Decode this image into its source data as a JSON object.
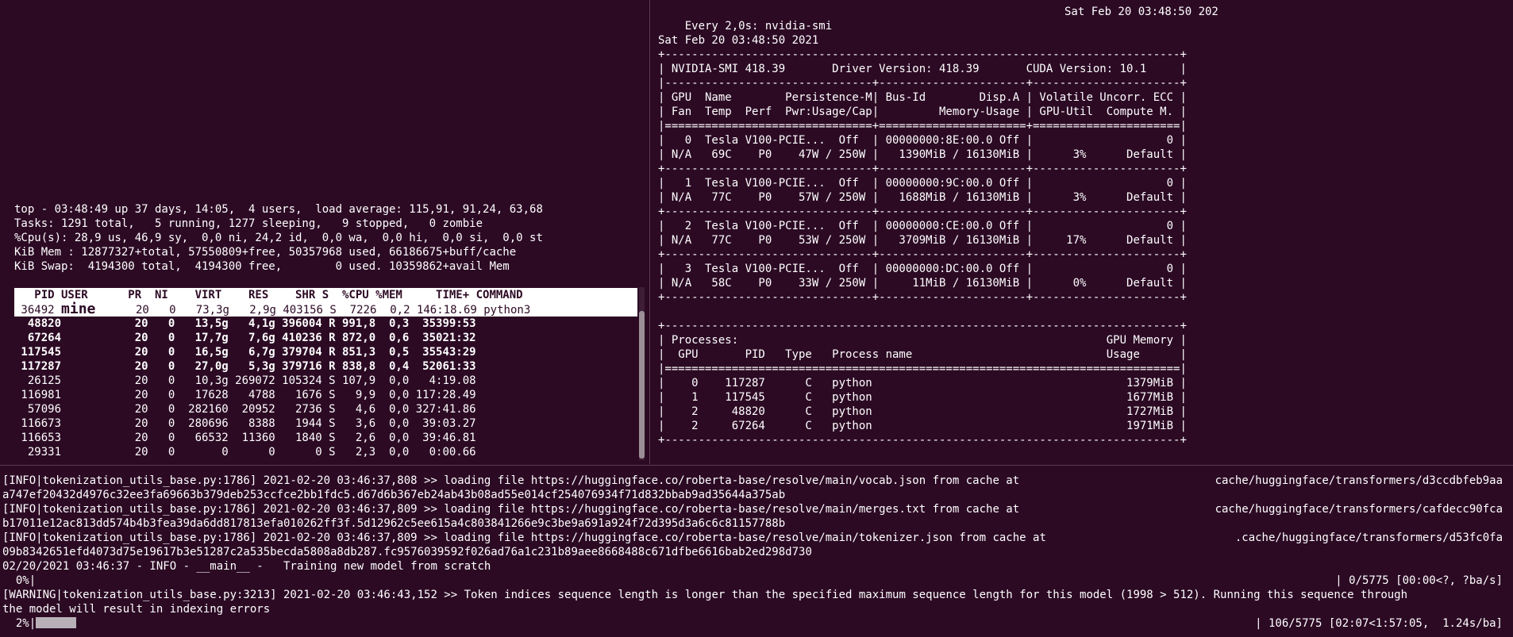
{
  "colors": {
    "background": "#2c0a24",
    "text": "#ffffff",
    "highlight_bg": "#ffffff",
    "highlight_text": "#2c0a24"
  },
  "watch_header": {
    "left": "Every 2,0s: nvidia-smi",
    "right": "Sat Feb 20 03:48:50 202"
  },
  "smi": [
    "Sat Feb 20 03:48:50 2021",
    "+-----------------------------------------------------------------------------+",
    "| NVIDIA-SMI 418.39       Driver Version: 418.39       CUDA Version: 10.1     |",
    "|-------------------------------+----------------------+----------------------+",
    "| GPU  Name        Persistence-M| Bus-Id        Disp.A | Volatile Uncorr. ECC |",
    "| Fan  Temp  Perf  Pwr:Usage/Cap|         Memory-Usage | GPU-Util  Compute M. |",
    "|===============================+======================+======================|",
    "|   0  Tesla V100-PCIE...  Off  | 00000000:8E:00.0 Off |                    0 |",
    "| N/A   69C    P0    47W / 250W |   1390MiB / 16130MiB |      3%      Default |",
    "+-------------------------------+----------------------+----------------------+",
    "|   1  Tesla V100-PCIE...  Off  | 00000000:9C:00.0 Off |                    0 |",
    "| N/A   77C    P0    57W / 250W |   1688MiB / 16130MiB |      3%      Default |",
    "+-------------------------------+----------------------+----------------------+",
    "|   2  Tesla V100-PCIE...  Off  | 00000000:CE:00.0 Off |                    0 |",
    "| N/A   77C    P0    53W / 250W |   3709MiB / 16130MiB |     17%      Default |",
    "+-------------------------------+----------------------+----------------------+",
    "|   3  Tesla V100-PCIE...  Off  | 00000000:DC:00.0 Off |                    0 |",
    "| N/A   58C    P0    33W / 250W |     11MiB / 16130MiB |      0%      Default |",
    "+-------------------------------+----------------------+----------------------+",
    "",
    "+-----------------------------------------------------------------------------+",
    "| Processes:                                                       GPU Memory |",
    "|  GPU       PID   Type   Process name                             Usage      |",
    "|=============================================================================|",
    "|    0    117287      C   python                                      1379MiB |",
    "|    1    117545      C   python                                      1677MiB |",
    "|    2     48820      C   python                                      1727MiB |",
    "|    2     67264      C   python                                      1971MiB |",
    "+-----------------------------------------------------------------------------+"
  ],
  "top": {
    "summary": [
      "top - 03:48:49 up 37 days, 14:05,  4 users,  load average: 115,91, 91,24, 63,68",
      "Tasks: 1291 total,   5 running, 1277 sleeping,   9 stopped,   0 zombie",
      "%Cpu(s): 28,9 us, 46,9 sy,  0,0 ni, 24,2 id,  0,0 wa,  0,0 hi,  0,0 si,  0,0 st",
      "KiB Mem : 12877327+total, 57550809+free, 50357968 used, 66186675+buff/cache",
      "KiB Swap:  4194300 total,  4194300 free,        0 used. 10359862+avail Mem"
    ],
    "header": "   PID USER      PR  NI    VIRT    RES    SHR S  %CPU %MEM     TIME+ COMMAND",
    "selected": {
      "pre": " 36492 ",
      "user": "mine",
      "post": "      20   0   73,3g   2,9g 403156 S  7226  0,2 146:18.69 python3"
    },
    "rows": [
      "  48820           20   0   13,5g   4,1g 396004 R 991,8  0,3  35399:53",
      "  67264           20   0   17,7g   7,6g 410236 R 872,0  0,6  35021:32",
      " 117545           20   0   16,5g   6,7g 379704 R 851,3  0,5  35543:29",
      " 117287           20   0   27,0g   5,3g 379716 R 838,8  0,4  52061:33",
      "  26125           20   0   10,3g 269072 105324 S 107,9  0,0   4:19.08",
      " 116981           20   0   17628   4788   1676 S   9,9  0,0 117:28.49",
      "  57096           20   0  282160  20952   2736 S   4,6  0,0 327:41.86",
      " 116673           20   0  280696   8388   1944 S   3,6  0,0  39:03.27",
      " 116653           20   0   66532  11360   1840 S   2,6  0,0  39:46.81",
      "  29331           20   0       0      0      0 S   2,3  0,0   0:00.66"
    ]
  },
  "log": {
    "l1": {
      "left": "[INFO|tokenization_utils_base.py:1786] 2021-02-20 03:46:37,808 >> loading file https://huggingface.co/roberta-base/resolve/main/vocab.json from cache at",
      "right": "cache/huggingface/transformers/d3ccdbfeb9aa"
    },
    "l2": "a747ef20432d4976c32ee3fa69663b379deb253ccfce2bb1fdc5.d67d6b367eb24ab43b08ad55e014cf254076934f71d832bbab9ad35644a375ab",
    "l3": {
      "left": "[INFO|tokenization_utils_base.py:1786] 2021-02-20 03:46:37,809 >> loading file https://huggingface.co/roberta-base/resolve/main/merges.txt from cache at",
      "right": "cache/huggingface/transformers/cafdecc90fca"
    },
    "l4": "b17011e12ac813dd574b4b3fea39da6dd817813efa010262ff3f.5d12962c5ee615a4c803841266e9c3be9a691a924f72d395d3a6c6c81157788b",
    "l5": {
      "left": "[INFO|tokenization_utils_base.py:1786] 2021-02-20 03:46:37,809 >> loading file https://huggingface.co/roberta-base/resolve/main/tokenizer.json from cache at",
      "right": ".cache/huggingface/transformers/d53fc0fa"
    },
    "l6": "09b8342651efd4073d75e19617b3e51287c2a535becda5808a8db287.fc9576039592f026ad76a1c231b89aee8668488c671dfbe6616bab2ed298d730",
    "l7": "02/20/2021 03:46:37 - INFO - __main__ -   Training new model from scratch",
    "l8": {
      "left": "  0%|",
      "right": "| 0/5775 [00:00<?, ?ba/s]",
      "progress": 0.0
    },
    "l9": "[WARNING|tokenization_utils_base.py:3213] 2021-02-20 03:46:43,152 >> Token indices sequence length is longer than the specified maximum sequence length for this model (1998 > 512). Running this sequence through",
    "l10": "the model will result in indexing errors",
    "l11": {
      "left": "  2%|",
      "right": "| 106/5775 [02:07<1:57:05,  1.24s/ba]",
      "progress": 0.02
    }
  }
}
